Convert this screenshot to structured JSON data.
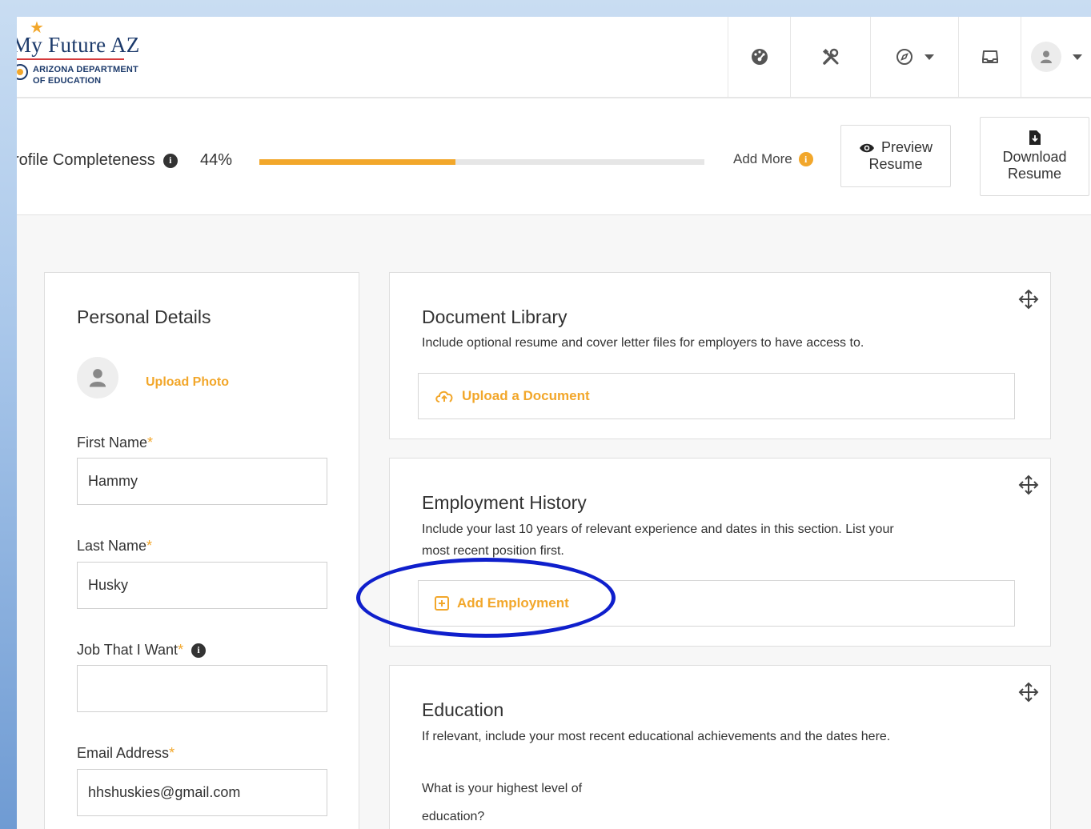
{
  "logo": {
    "name": "My Future AZ",
    "dept_line1": "ARIZONA DEPARTMENT",
    "dept_line2": "OF EDUCATION"
  },
  "nav": {
    "items": [
      "dashboard-icon",
      "tools-icon",
      "compass-icon",
      "inbox-icon",
      "user-icon"
    ]
  },
  "profile": {
    "completeness_label": "rofile Completeness",
    "percent_text": "44%",
    "percent_value": 0.44,
    "add_more_label": "Add More",
    "preview_label_1": "Preview",
    "preview_label_2": "Resume",
    "download_label_1": "Download",
    "download_label_2": "Resume"
  },
  "personal": {
    "title": "Personal Details",
    "upload_photo": "Upload Photo",
    "first_name_label": "First Name",
    "first_name_value": "Hammy",
    "last_name_label": "Last Name",
    "last_name_value": "Husky",
    "job_label": "Job That I Want",
    "job_value": "",
    "email_label": "Email Address",
    "email_value": "hhshuskies@gmail.com",
    "required_mark": "*"
  },
  "document_library": {
    "title": "Document Library",
    "description": "Include optional resume and cover letter files for employers to have access to.",
    "action": "Upload a Document"
  },
  "employment": {
    "title": "Employment History",
    "description_1": "Include your last 10 years of relevant experience and dates in this section. List your",
    "description_2": "most recent position first.",
    "action": "Add Employment"
  },
  "education": {
    "title": "Education",
    "description": "If relevant, include your most recent educational achievements and the dates here.",
    "question_1": "What is your highest level of",
    "question_2": "education?"
  },
  "colors": {
    "accent": "#f2a72b",
    "highlight_ring": "#0f1fcc",
    "logo_blue": "#1c3a6b"
  }
}
